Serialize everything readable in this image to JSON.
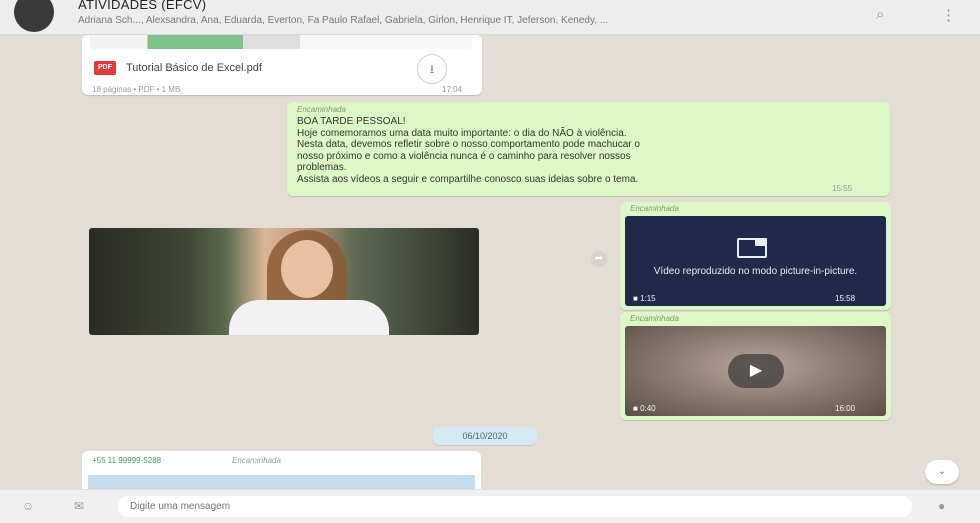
{
  "header": {
    "title": "ATIVIDADES (EFCV)",
    "participants": "Adriana Sch..., Alexsandra, Ana, Eduarda, Everton, Fa Paulo Rafael, Gabriela, Girlon, Henrique IT, Jeferson, Kenedy, ...",
    "icons": [
      "search-icon",
      "menu-icon"
    ]
  },
  "chat": {
    "file_message": {
      "name": "Tutorial Básico de Excel.pdf",
      "meta_left": "18 páginas • PDF • 1 MB",
      "meta_right": "17:04"
    },
    "text_message": {
      "forward_label": "Encaminhada",
      "lines": [
        "BOA TARDE PESSOAL!",
        "Hoje comemoramos uma data muito importante: o dia do NÃO à violência.",
        "Nesta data, devemos refletir sobre o nosso comportamento pode machucar o",
        "nosso próximo e como a violência nunca é o caminho para resolver nossos",
        "problemas.",
        "Assista aos vídeos a seguir e compartilhe conosco suas ideias sobre o tema."
      ],
      "time": "15:55"
    },
    "video_pip": {
      "forward_label": "Encaminhada",
      "text": "Vídeo reproduzido no modo picture-in-picture.",
      "duration": "1:15",
      "time": "15:58"
    },
    "video_blur": {
      "forward_label": "Encaminhada",
      "duration": "0:40",
      "time": "16:00"
    },
    "date_divider": "06/10/2020",
    "lower_message": {
      "sender": "+55 11 99999-5288",
      "forward_label": "Encaminhada"
    }
  },
  "composer": {
    "placeholder": "Digite uma mensagem",
    "icons": [
      "emoji-icon",
      "attach-icon",
      "mic-icon"
    ]
  },
  "colors": {
    "incoming": "#ffffff",
    "outgoing": "#dcf8c6",
    "header": "#ededed",
    "background": "#e4ddd5"
  }
}
